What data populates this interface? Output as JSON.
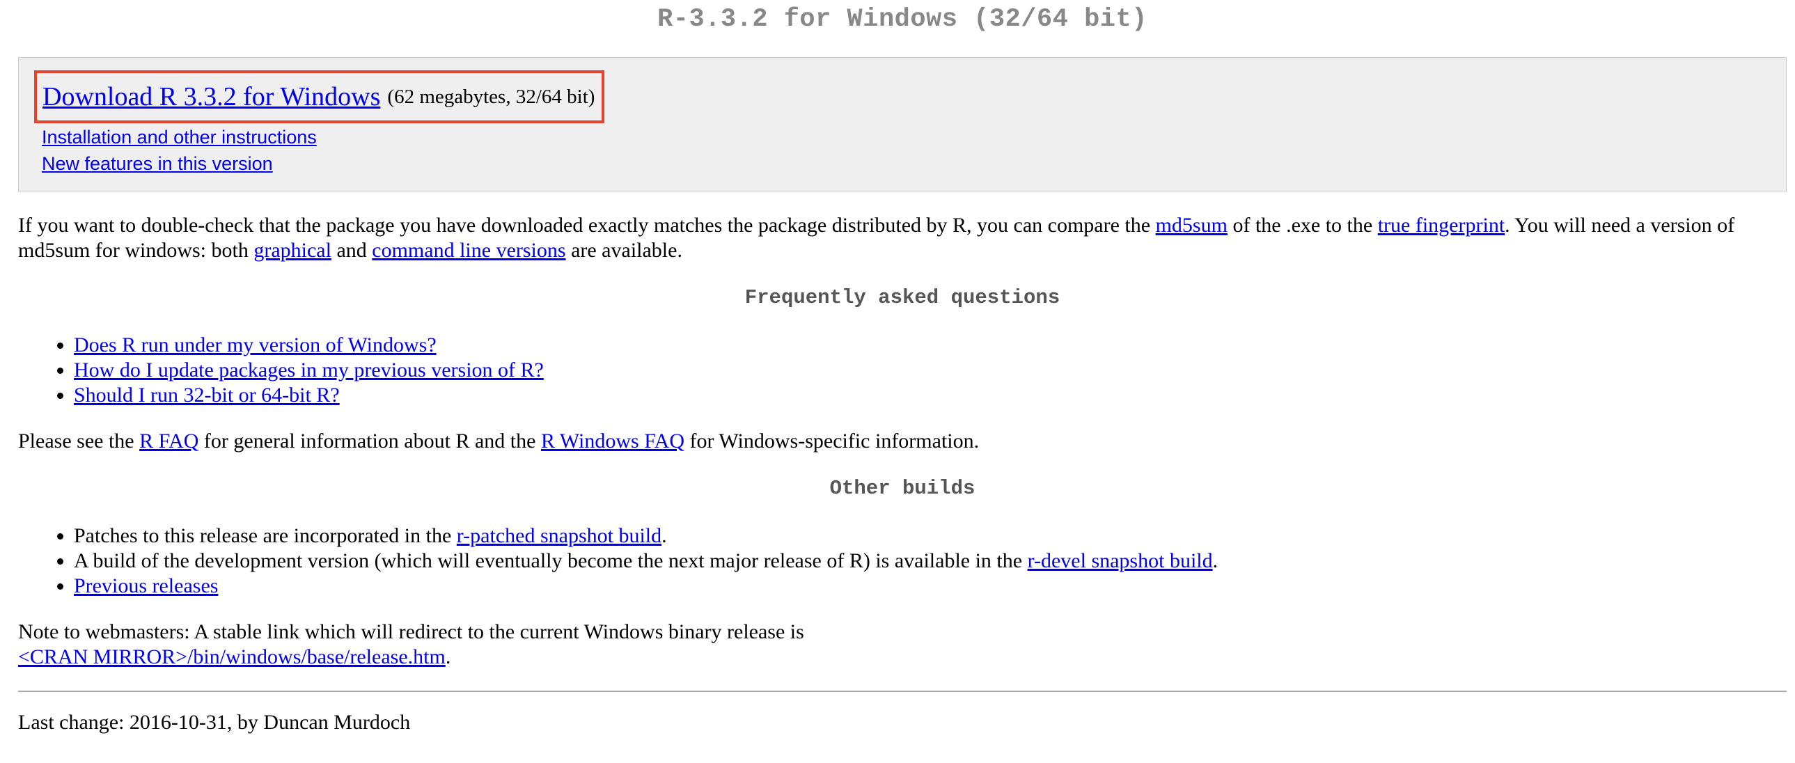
{
  "title": "R-3.3.2 for Windows (32/64 bit)",
  "download": {
    "link_text": "Download R 3.3.2 for Windows",
    "meta": "(62 megabytes, 32/64 bit)",
    "links": [
      "Installation and other instructions",
      "New features in this version"
    ]
  },
  "checksum": {
    "t1": "If you want to double-check that the package you have downloaded exactly matches the package distributed by R, you can compare the ",
    "md5sum_link": "md5sum",
    "t2": " of the .exe to the ",
    "fingerprint_link": "true fingerprint",
    "t3": ". You will need a version of md5sum for windows: both ",
    "graphical_link": "graphical",
    "t4": " and ",
    "cmdline_link": "command line versions",
    "t5": " are available."
  },
  "faq": {
    "heading": "Frequently asked questions",
    "items": [
      "Does R run under my version of Windows?",
      "How do I update packages in my previous version of R?",
      "Should I run 32-bit or 64-bit R?"
    ]
  },
  "faq_note": {
    "t1": "Please see the ",
    "rfaq_link": "R FAQ",
    "t2": " for general information about R and the ",
    "rwinfaq_link": "R Windows FAQ",
    "t3": " for Windows-specific information."
  },
  "other_builds": {
    "heading": "Other builds",
    "item1_text": "Patches to this release are incorporated in the ",
    "item1_link": "r-patched snapshot build",
    "item1_end": ".",
    "item2_text": "A build of the development version (which will eventually become the next major release of R) is available in the ",
    "item2_link": "r-devel snapshot build",
    "item2_end": ".",
    "item3_link": "Previous releases"
  },
  "webmasters": {
    "text": "Note to webmasters: A stable link which will redirect to the current Windows binary release is",
    "link": "<CRAN MIRROR>/bin/windows/base/release.htm",
    "end": "."
  },
  "footer": {
    "last_change": "Last change: 2016-10-31, by Duncan Murdoch"
  },
  "colors": {
    "link": "#0000ee",
    "highlight_border": "#e5432e",
    "panel_background": "#efefef",
    "title": "#888888"
  }
}
